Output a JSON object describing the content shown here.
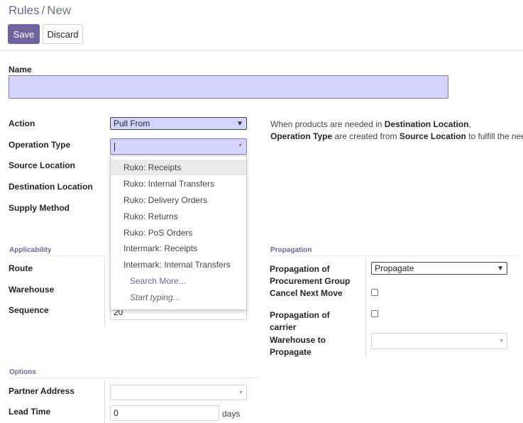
{
  "breadcrumb": {
    "root": "Rules",
    "separator": "/",
    "current": "New"
  },
  "toolbar": {
    "save_label": "Save",
    "discard_label": "Discard"
  },
  "form": {
    "name_label": "Name",
    "name_value": "",
    "action_label": "Action",
    "action_value": "Pull From",
    "operation_type_label": "Operation Type",
    "operation_type_value": "",
    "source_location_label": "Source Location",
    "destination_location_label": "Destination Location",
    "supply_method_label": "Supply Method",
    "help_line1_prefix": "When products are needed in ",
    "help_line1_bold": "Destination Location",
    "help_line1_suffix": ",",
    "help_line2_bold1": "Operation Type",
    "help_line2_mid1": " are created from ",
    "help_line2_bold2": "Source Location",
    "help_line2_suffix": " to fulfill the need."
  },
  "dropdown": {
    "items": [
      "Ruko: Receipts",
      "Ruko: Internal Transfers",
      "Ruko: Delivery Orders",
      "Ruko: Returns",
      "Ruko: PoS Orders",
      "Intermark: Receipts",
      "Intermark: Internal Transfers"
    ],
    "search_more": "Search More...",
    "hint": "Start typing..."
  },
  "applicability": {
    "title": "Applicability",
    "route_label": "Route",
    "warehouse_label": "Warehouse",
    "sequence_label": "Sequence",
    "sequence_value": "20"
  },
  "propagation": {
    "title": "Propagation",
    "procurement_label_1": "Propagation of",
    "procurement_label_2": "Procurement Group",
    "procurement_value": "Propagate",
    "cancel_next_label": "Cancel Next Move",
    "carrier_label_1": "Propagation of",
    "carrier_label_2": "carrier",
    "warehouse_label_1": "Warehouse to",
    "warehouse_label_2": "Propagate"
  },
  "options": {
    "title": "Options",
    "partner_label": "Partner Address",
    "lead_time_label": "Lead Time",
    "lead_time_value": "0",
    "lead_time_unit": "days"
  },
  "colors": {
    "accent": "#71639e",
    "input_highlight": "#d4d4ff"
  },
  "icons": [
    "chevron-down-icon",
    "caret-down-icon"
  ]
}
